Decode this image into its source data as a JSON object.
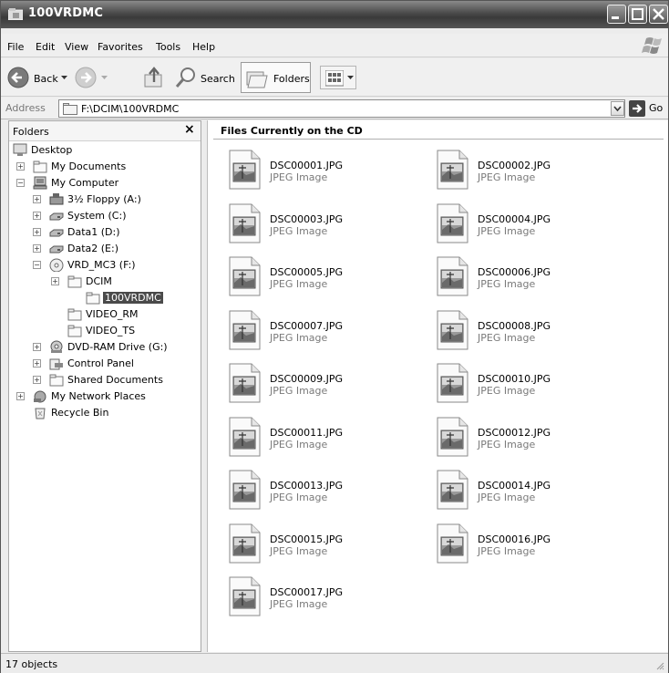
{
  "window": {
    "title": "100VRDMC"
  },
  "menu": [
    "File",
    "Edit",
    "View",
    "Favorites",
    "Tools",
    "Help"
  ],
  "toolbar": {
    "back": "Back",
    "search": "Search",
    "folders": "Folders"
  },
  "address": {
    "label": "Address",
    "value": "F:\\DCIM\\100VRDMC",
    "go": "Go"
  },
  "folders_pane": {
    "title": "Folders",
    "close": "×",
    "tree": [
      {
        "label": "Desktop",
        "icon": "desktop-icon",
        "expander": ""
      },
      {
        "label": "My Documents",
        "icon": "folder-icon",
        "expander": "+"
      },
      {
        "label": "My Computer",
        "icon": "computer-icon",
        "expander": "−"
      },
      {
        "label": "3½ Floppy (A:)",
        "icon": "floppy-icon",
        "expander": "+"
      },
      {
        "label": "System (C:)",
        "icon": "hard-drive-icon",
        "expander": "+"
      },
      {
        "label": "Data1 (D:)",
        "icon": "hard-drive-icon",
        "expander": "+"
      },
      {
        "label": "Data2 (E:)",
        "icon": "hard-drive-icon",
        "expander": "+"
      },
      {
        "label": "VRD_MC3 (F:)",
        "icon": "cd-drive-icon",
        "expander": "−"
      },
      {
        "label": "DCIM",
        "icon": "folder-icon",
        "expander": "+"
      },
      {
        "label": "100VRDMC",
        "icon": "folder-icon",
        "expander": "",
        "selected": true
      },
      {
        "label": "VIDEO_RM",
        "icon": "folder-icon",
        "expander": ""
      },
      {
        "label": "VIDEO_TS",
        "icon": "folder-icon",
        "expander": ""
      },
      {
        "label": "DVD-RAM Drive (G:)",
        "icon": "dvd-drive-icon",
        "expander": "+"
      },
      {
        "label": "Control Panel",
        "icon": "control-panel-icon",
        "expander": "+"
      },
      {
        "label": "Shared Documents",
        "icon": "folder-icon",
        "expander": "+"
      },
      {
        "label": "My Network Places",
        "icon": "network-icon",
        "expander": "+"
      },
      {
        "label": "Recycle Bin",
        "icon": "recycle-bin-icon",
        "expander": ""
      }
    ]
  },
  "content": {
    "heading": "Files Currently on the CD",
    "files": [
      {
        "name": "DSC00001.JPG",
        "type": "JPEG Image"
      },
      {
        "name": "DSC00002.JPG",
        "type": "JPEG Image"
      },
      {
        "name": "DSC00003.JPG",
        "type": "JPEG Image"
      },
      {
        "name": "DSC00004.JPG",
        "type": "JPEG Image"
      },
      {
        "name": "DSC00005.JPG",
        "type": "JPEG Image"
      },
      {
        "name": "DSC00006.JPG",
        "type": "JPEG Image"
      },
      {
        "name": "DSC00007.JPG",
        "type": "JPEG Image"
      },
      {
        "name": "DSC00008.JPG",
        "type": "JPEG Image"
      },
      {
        "name": "DSC00009.JPG",
        "type": "JPEG Image"
      },
      {
        "name": "DSC00010.JPG",
        "type": "JPEG Image"
      },
      {
        "name": "DSC00011.JPG",
        "type": "JPEG Image"
      },
      {
        "name": "DSC00012.JPG",
        "type": "JPEG Image"
      },
      {
        "name": "DSC00013.JPG",
        "type": "JPEG Image"
      },
      {
        "name": "DSC00014.JPG",
        "type": "JPEG Image"
      },
      {
        "name": "DSC00015.JPG",
        "type": "JPEG Image"
      },
      {
        "name": "DSC00016.JPG",
        "type": "JPEG Image"
      },
      {
        "name": "DSC00017.JPG",
        "type": "JPEG Image"
      }
    ]
  },
  "status": {
    "text": "17 objects"
  }
}
